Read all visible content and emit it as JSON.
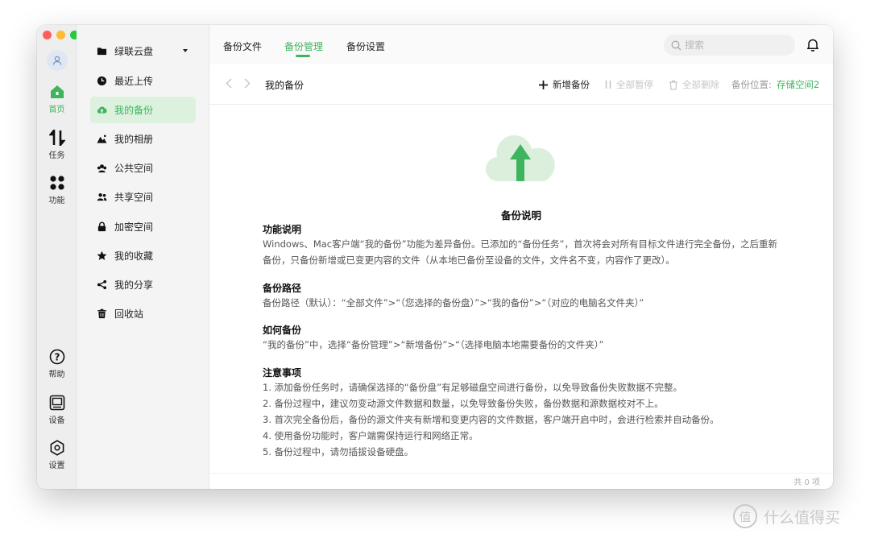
{
  "rail": {
    "items": [
      {
        "label": "首页",
        "icon": "home-icon"
      },
      {
        "label": "任务",
        "icon": "transfer-icon"
      },
      {
        "label": "功能",
        "icon": "apps-icon"
      },
      {
        "label": "帮助",
        "icon": "help-icon"
      },
      {
        "label": "设备",
        "icon": "device-icon"
      },
      {
        "label": "设置",
        "icon": "settings-icon"
      }
    ]
  },
  "sidebar": {
    "items": [
      {
        "label": "绿联云盘",
        "icon": "folder-icon"
      },
      {
        "label": "最近上传",
        "icon": "clock-icon"
      },
      {
        "label": "我的备份",
        "icon": "cloud-upload-icon"
      },
      {
        "label": "我的相册",
        "icon": "mountain-icon"
      },
      {
        "label": "公共空间",
        "icon": "group-icon"
      },
      {
        "label": "共享空间",
        "icon": "users-icon"
      },
      {
        "label": "加密空间",
        "icon": "lock-icon"
      },
      {
        "label": "我的收藏",
        "icon": "star-icon"
      },
      {
        "label": "我的分享",
        "icon": "share-icon"
      },
      {
        "label": "回收站",
        "icon": "trash-icon"
      }
    ]
  },
  "tabs": [
    {
      "label": "备份文件"
    },
    {
      "label": "备份管理"
    },
    {
      "label": "备份设置"
    }
  ],
  "search": {
    "placeholder": "搜索"
  },
  "toolbar": {
    "breadcrumb": "我的备份",
    "add_label": "新增备份",
    "pause_label": "全部暂停",
    "delete_label": "全部删除",
    "location_label": "备份位置:",
    "location_value": "存储空间2"
  },
  "doc": {
    "title": "备份说明",
    "sections": [
      {
        "heading": "功能说明",
        "lines": [
          "Windows、Mac客户端“我的备份”功能为差异备份。已添加的“备份任务”，首次将会对所有目标文件进行完全备份，之后重新",
          "备份，只备份新增或已变更内容的文件（从本地已备份至设备的文件，文件名不变，内容作了更改）。"
        ]
      },
      {
        "heading": "备份路径",
        "lines": [
          "备份路径（默认）：“全部文件”>“（您选择的备份盘）”>“我的备份”>“（对应的电脑名文件夹）”"
        ]
      },
      {
        "heading": "如何备份",
        "lines": [
          "“我的备份”中，选择“备份管理”>“新增备份”>“（选择电脑本地需要备份的文件夹）”"
        ]
      },
      {
        "heading": "注意事项",
        "lines": [
          "1. 添加备份任务时，请确保选择的“备份盘”有足够磁盘空间进行备份，以免导致备份失败数据不完整。",
          "2. 备份过程中，建议勿变动源文件数据和数量，以免导致备份失败，备份数据和源数据校对不上。",
          "3. 首次完全备份后，备份的源文件夹有新增和变更内容的文件数据，客户端开启中时，会进行检索并自动备份。",
          "4. 使用备份功能时，客户端需保持运行和网络正常。",
          "5. 备份过程中，请勿插拔设备硬盘。"
        ]
      }
    ]
  },
  "footer": {
    "count": "共 0 项"
  },
  "watermark": {
    "logo_char": "值",
    "text": "什么值得买"
  },
  "colors": {
    "accent": "#3fb45f",
    "active_bg": "#ddf1df"
  }
}
